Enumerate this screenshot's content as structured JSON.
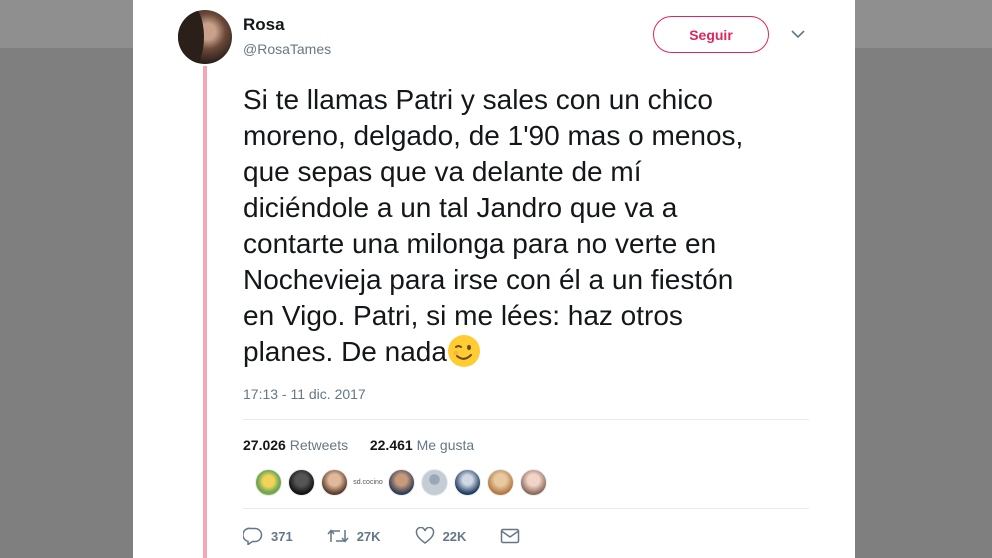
{
  "tweet": {
    "display_name": "Rosa",
    "handle": "@RosaTames",
    "follow_label": "Seguir",
    "text_lines": [
      "Si te llamas Patri y sales con un chico",
      "moreno, delgado, de 1'90 mas o menos,",
      "que sepas que va delante de mí",
      "diciéndole a un tal Jandro que va a",
      "contarte una milonga para no verte en",
      "Nochevieja para irse con él a un fiestón",
      "en Vigo.  Patri, si me lées: haz otros",
      "planes. De nada"
    ],
    "emoji": "winking-face",
    "timestamp": "17:13 - 11 dic. 2017"
  },
  "stats": {
    "retweets_count": "27.026",
    "retweets_label": "Retweets",
    "likes_count": "22.461",
    "likes_label": "Me gusta"
  },
  "likers": {
    "text_avatar": "sd.cocino"
  },
  "actions": {
    "replies": "371",
    "retweets": "27K",
    "likes": "22K"
  },
  "colors": {
    "accent": "#e0245e",
    "thread_line": "#f4a6b5",
    "secondary_text": "#657786",
    "primary_text": "#14171a"
  }
}
